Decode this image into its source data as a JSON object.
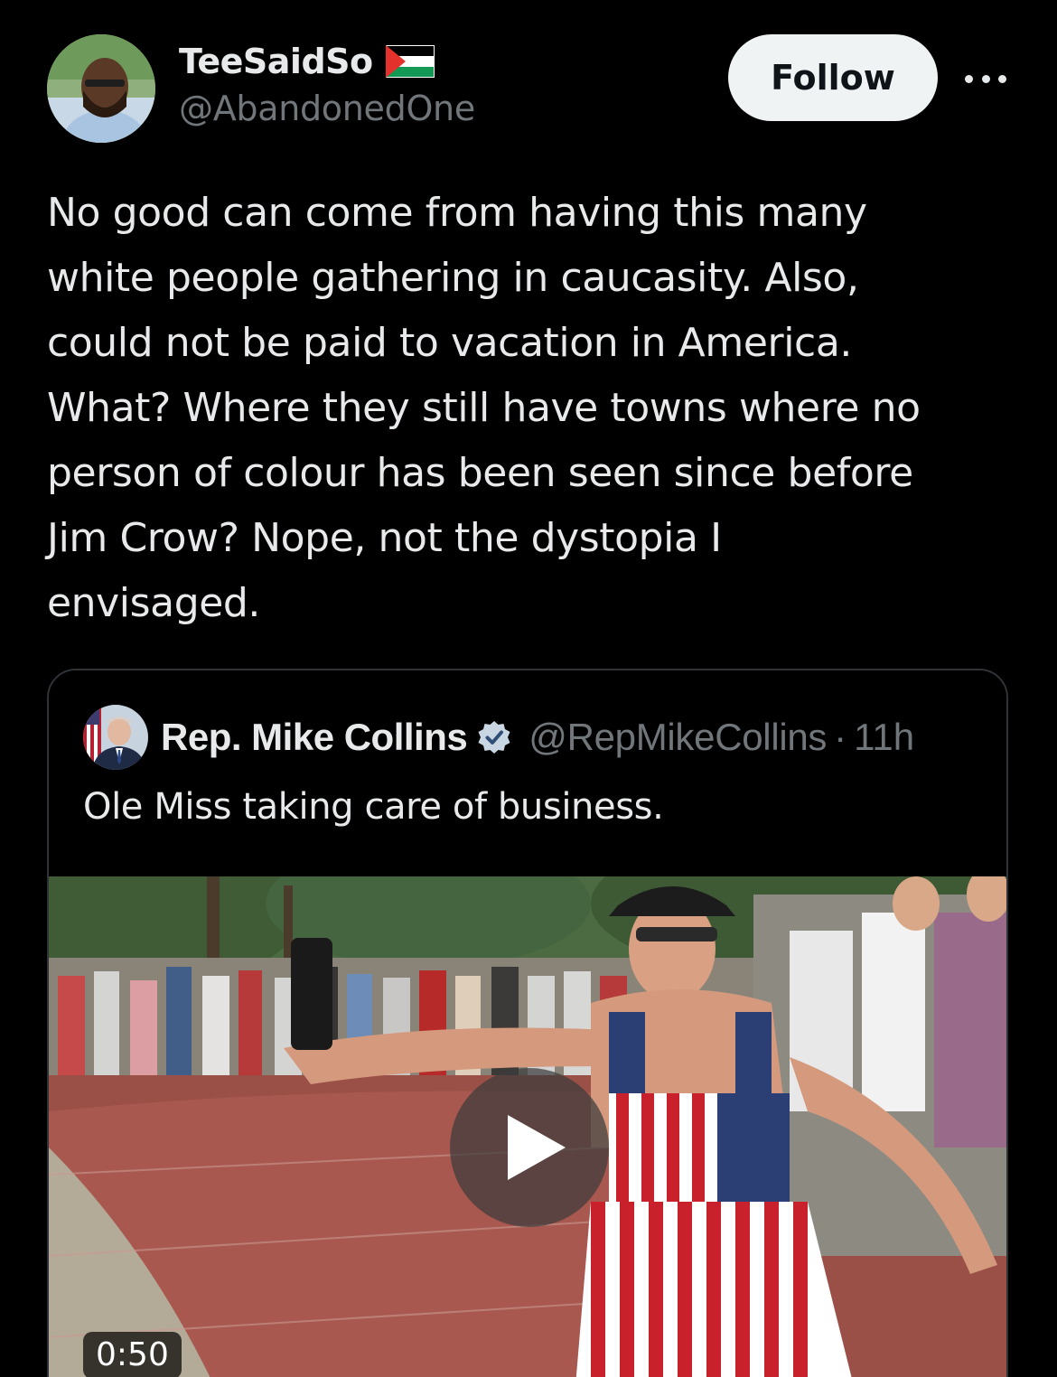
{
  "author": {
    "display_name": "TeeSaidSo",
    "handle": "@AbandonedOne",
    "avatar_icon": "profile-photo",
    "flag_icon": "palestine-flag-icon"
  },
  "actions": {
    "follow_label": "Follow",
    "more_icon": "more-options-icon"
  },
  "tweet": {
    "text": "No good can come from having this many\nwhite people gathering in caucasity. Also,\ncould not be paid to vacation in America.\nWhat? Where they still have towns where no\nperson of colour has been seen since before\nJim Crow? Nope, not the dystopia I\nenvisaged."
  },
  "quoted_tweet": {
    "display_name": "Rep. Mike Collins",
    "verified_icon": "verified-badge-icon",
    "verified_color": "#1d9bf0",
    "handle": "@RepMikeCollins",
    "separator": "·",
    "time": "11h",
    "text": "Ole Miss taking care of business.",
    "media": {
      "type": "video",
      "duration": "0:50",
      "play_icon": "play-icon"
    }
  },
  "colors": {
    "background": "#000000",
    "primary_text": "#e7e9ea",
    "secondary_text": "#71767b",
    "border": "#2f3336",
    "follow_bg": "#eff3f4"
  }
}
